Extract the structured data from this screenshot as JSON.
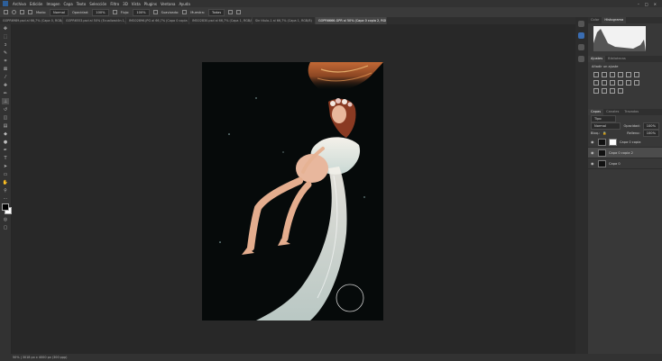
{
  "menu": [
    "Archivo",
    "Edición",
    "Imagen",
    "Capa",
    "Texto",
    "Selección",
    "Filtro",
    "3D",
    "Vista",
    "Plugins",
    "Ventana",
    "Ayuda"
  ],
  "options": {
    "modo_label": "Modo:",
    "modo_value": "Normal",
    "opacidad_label": "Opacidad:",
    "opacidad_value": "100%",
    "flujo_label": "Flujo:",
    "flujo_value": "100%",
    "suavizado_label": "Suavizado:",
    "muestra_label": "Muestra:",
    "muestra_value": "Todas"
  },
  "tabs": [
    "GOPR6989.psd al 66,7% (Capa 0, RGB/8) *",
    "GOPR6553.psd al 50% (Ecualización 1, Máscara de capa/8)",
    "IMG02896.JPG al 66,7% (Capa 0 copia 2, RGB/8)",
    "IMG02830.psd al 66,7% (Capa 1, RGB/8)",
    "Sin título-1 al 66,7% (Capa 1, RGB/8)",
    "GOPR6666-GPR al 50% (Capa 0 copia 2, RGB/8) *"
  ],
  "status": "50% | 3018 px x 4000 px (300 ppp)",
  "panels": {
    "top_tabs": [
      "Color",
      "Histograma"
    ],
    "adj_tabs": [
      "Ajustes",
      "Bibliotecas"
    ],
    "adj_title": "Añadir un ajuste",
    "layer_tabs": [
      "Capas",
      "Canales",
      "Trazados"
    ],
    "kind_value": "Tipo",
    "blend_value": "Normal",
    "opacity_label": "Opacidad:",
    "opacity_value": "100%",
    "lock_label": "Bloq.:",
    "fill_label": "Relleno:",
    "fill_value": "100%",
    "layers": [
      "Capa 0 copia",
      "Capa 0 copia 2",
      "Capa 0"
    ]
  },
  "colors": {
    "accent": "#2d8ceb",
    "panel": "#383838",
    "canvas": "#282828"
  }
}
